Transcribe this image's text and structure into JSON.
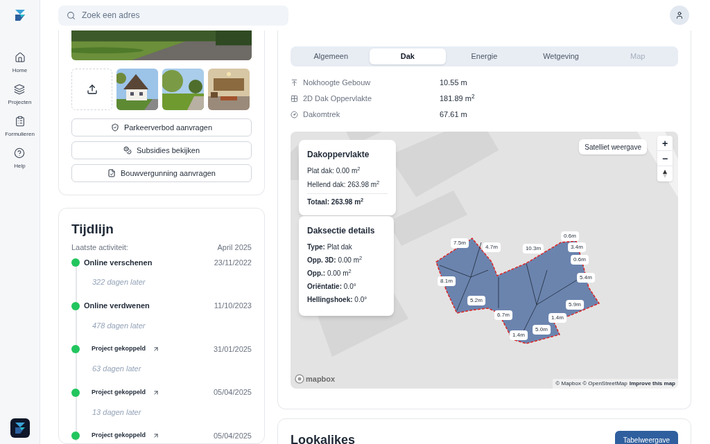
{
  "search": {
    "placeholder": "Zoek een adres"
  },
  "sidebar": {
    "items": [
      {
        "label": "Home",
        "selected": false
      },
      {
        "label": "Projecten",
        "selected": false
      },
      {
        "label": "Formulieren",
        "selected": false
      },
      {
        "label": "Help",
        "selected": false
      }
    ]
  },
  "actions": [
    {
      "label": "Parkeerverbod aanvragen",
      "kind": "parking"
    },
    {
      "label": "Subsidies bekijken",
      "kind": "coins"
    },
    {
      "label": "Bouwvergunning aanvragen",
      "kind": "document"
    }
  ],
  "timeline": {
    "title": "Tijdlijn",
    "subtitle": "Laatste activiteit:",
    "latest": "April 2025",
    "items": [
      {
        "kind": "event",
        "label": "Online verschenen",
        "date": "23/11/2022",
        "gap": "322 dagen later",
        "color": "#22c55e"
      },
      {
        "kind": "event",
        "label": "Online verdwenen",
        "date": "11/10/2023",
        "gap": "478 dagen later",
        "color": "#22c55e"
      },
      {
        "kind": "project",
        "label": "Project gekoppeld",
        "date": "31/01/2025",
        "gap": "63 dagen later",
        "color": "#22c55e"
      },
      {
        "kind": "project",
        "label": "Project gekoppeld",
        "date": "05/04/2025",
        "gap": "13 dagen later",
        "color": "#22c55e"
      },
      {
        "kind": "project",
        "label": "Project gekoppeld",
        "date": "05/04/2025",
        "color": "#22c55e"
      }
    ]
  },
  "tabs": [
    {
      "label": "Algemeen",
      "selected": false,
      "disabled": false
    },
    {
      "label": "Dak",
      "selected": true,
      "disabled": false
    },
    {
      "label": "Energie",
      "selected": false,
      "disabled": false
    },
    {
      "label": "Wetgeving",
      "selected": false,
      "disabled": false
    },
    {
      "label": "Map",
      "selected": false,
      "disabled": true
    }
  ],
  "stats": [
    {
      "kind": "height",
      "label": "Nokhoogte Gebouw",
      "value": "10.55 m"
    },
    {
      "kind": "area",
      "label": "2D Dak Oppervlakte",
      "value": "181.89 m$^{2}$"
    },
    {
      "kind": "perimeter",
      "label": "Dakomtrek",
      "value": "67.61 m"
    }
  ],
  "map": {
    "area_card": {
      "title": "Dakoppervlakte",
      "lines": [
        "Plat dak: 0.00 m$^{2}$",
        "Hellend dak: 263.98 m$^{2}$"
      ],
      "total": "Totaal: 263.98 m$^{2}$"
    },
    "section_card": {
      "title": "Daksectie details",
      "lines": [
        "**Type:** Plat dak",
        "**Opp. 3D:** 0.00 m$^{2}$",
        "**Opp.:** 0.00 m$^{2}$",
        "**Oriëntatie:** 0.0°",
        "**Hellingshoek:** 0.0°"
      ]
    },
    "satellite_button": "Satelliet weergave",
    "zoom_in": "+",
    "zoom_out": "−",
    "measurements": [
      "7.5m",
      "4.7m",
      "10.3m",
      "0.6m",
      "3.4m",
      "0.6m",
      "5.4m",
      "8.1m",
      "5.2m",
      "5.9m",
      "6.7m",
      "1.4m",
      "5.0m",
      "1.4m"
    ],
    "logo": "mapbox",
    "attribution": "© Mapbox © OpenStreetMap",
    "improve_link": "Improve this map"
  },
  "lookalikes": {
    "title": "Lookalikes",
    "button": "Tabelweergave"
  }
}
